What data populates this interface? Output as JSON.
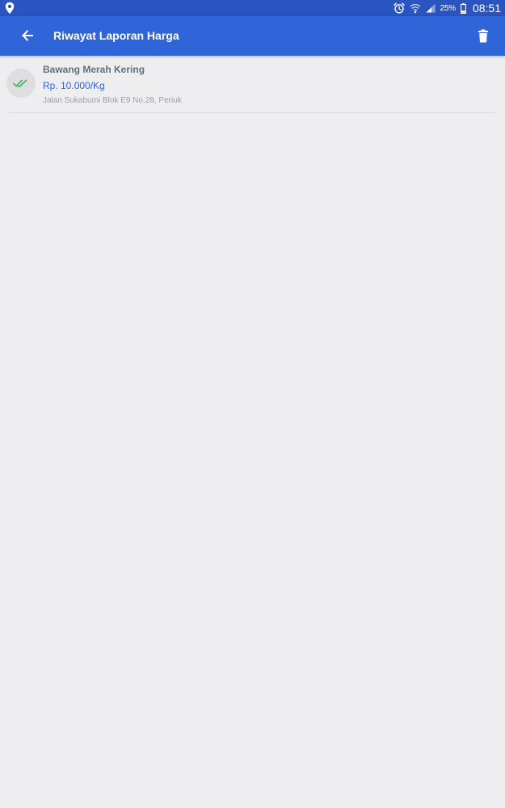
{
  "status_bar": {
    "battery_percent": "25%",
    "time": "08:51",
    "icons": [
      "location-icon",
      "alarm-icon",
      "wifi-icon",
      "signal-icon",
      "battery-icon"
    ]
  },
  "app_bar": {
    "title": "Riwayat Laporan Harga",
    "icons": [
      "back-arrow-icon",
      "trash-icon"
    ],
    "color": "#2f65d9"
  },
  "history": {
    "items": [
      {
        "name": "Bawang Merah Kering",
        "price": "Rp. 10.000/Kg",
        "address": "Jalan Sukabumi Blok E9 No.28, Periuk",
        "status_icon": "double-check-icon",
        "status_color": "#3cb14a"
      }
    ]
  }
}
